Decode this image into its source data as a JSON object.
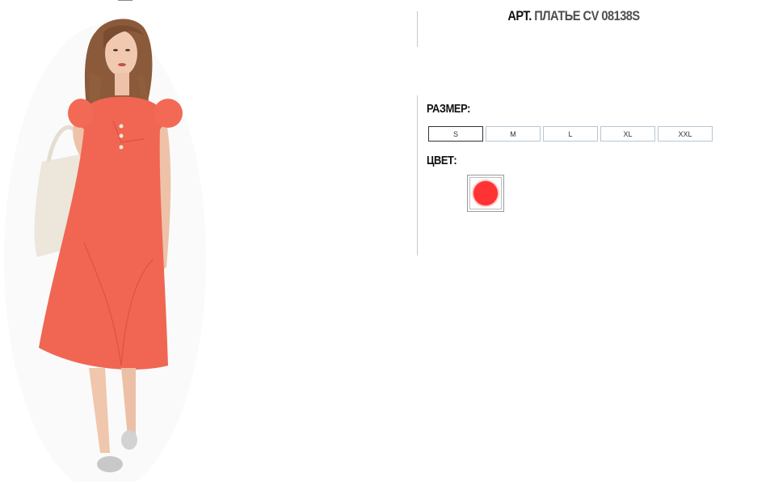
{
  "product": {
    "title_prefix": "АРТ.",
    "title_name": "ПЛАТЬЕ CV 08138S"
  },
  "options": {
    "size_label": "РАЗМЕР:",
    "sizes": [
      "S",
      "M",
      "L",
      "XL",
      "XXL"
    ],
    "selected_size": "S",
    "color_label": "ЦВЕТ:",
    "colors": [
      {
        "name": "red",
        "hex": "#ff3333",
        "selected": true
      }
    ]
  },
  "colors": {
    "dress": "#f06652",
    "swatch_red": "#ff3333",
    "divider": "#c9c9c9",
    "size_border": "#b8c6d3"
  }
}
